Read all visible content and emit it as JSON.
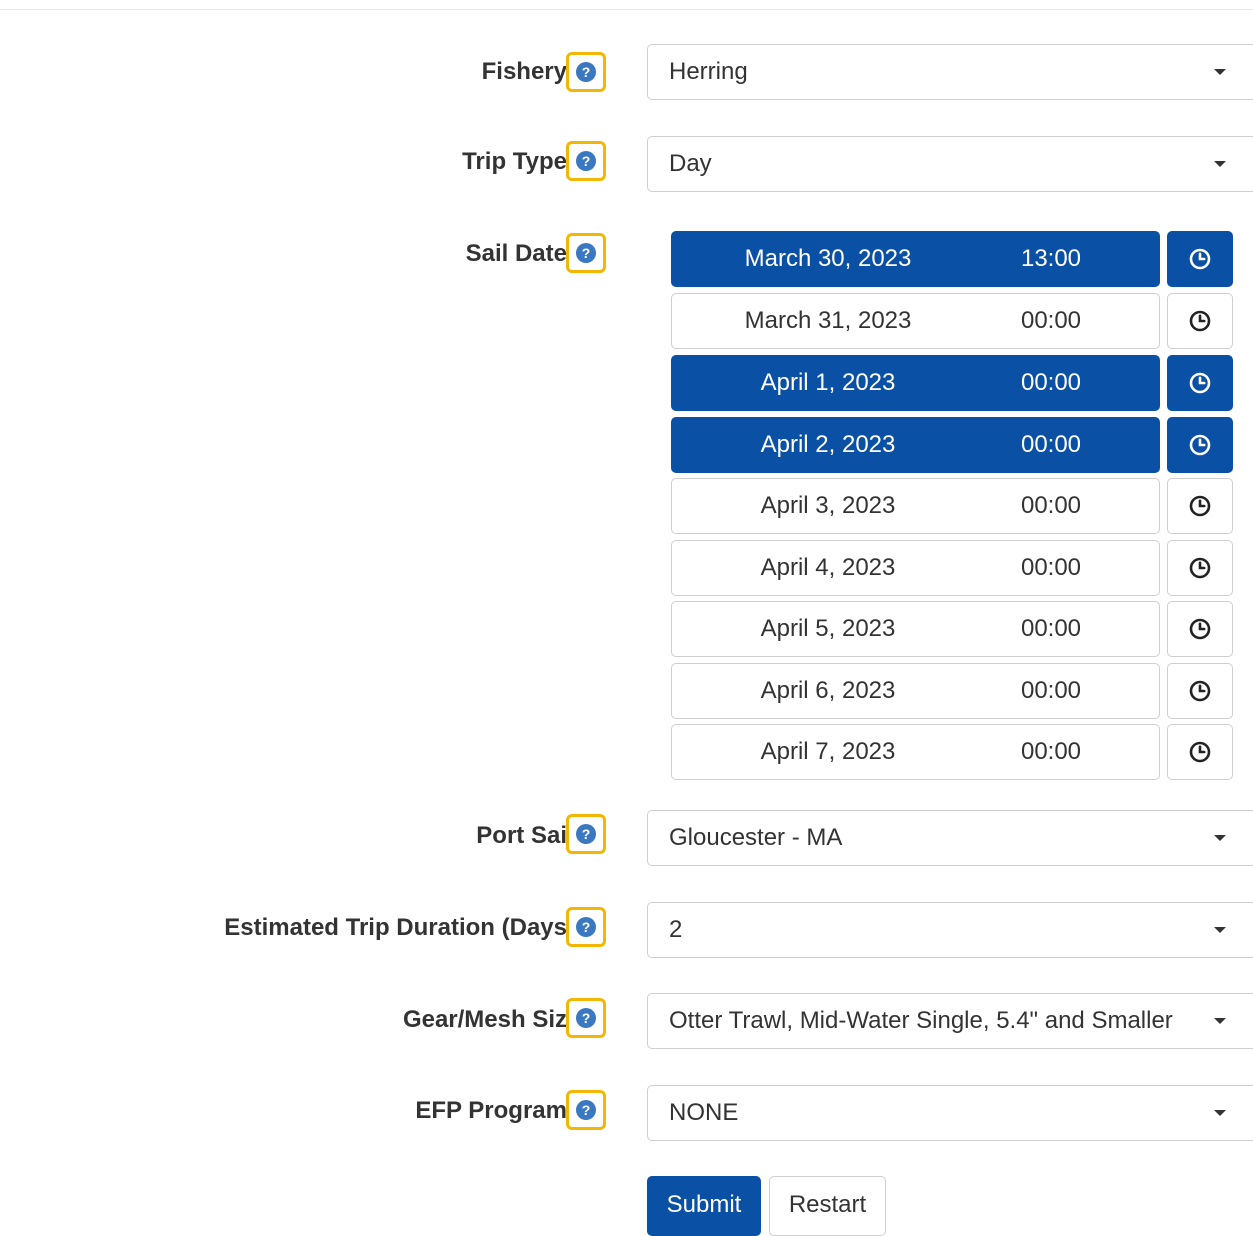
{
  "colors": {
    "accent": "#0a50a4",
    "help_border": "#f2b705",
    "help_icon": "#3a78c2"
  },
  "fishery": {
    "label": "Fishery",
    "value": "Herring",
    "help_icon": "question-circle-icon"
  },
  "trip_type": {
    "label": "Trip Type",
    "value": "Day"
  },
  "sail_date": {
    "label": "Sail Date",
    "rows": [
      {
        "date": "March 30, 2023",
        "time": "13:00",
        "selected": true
      },
      {
        "date": "March 31, 2023",
        "time": "00:00",
        "selected": false
      },
      {
        "date": "April 1, 2023",
        "time": "00:00",
        "selected": true
      },
      {
        "date": "April 2, 2023",
        "time": "00:00",
        "selected": true
      },
      {
        "date": "April 3, 2023",
        "time": "00:00",
        "selected": false
      },
      {
        "date": "April 4, 2023",
        "time": "00:00",
        "selected": false
      },
      {
        "date": "April 5, 2023",
        "time": "00:00",
        "selected": false
      },
      {
        "date": "April 6, 2023",
        "time": "00:00",
        "selected": false
      },
      {
        "date": "April 7, 2023",
        "time": "00:00",
        "selected": false
      }
    ]
  },
  "port_sail": {
    "label": "Port Sai",
    "value": "Gloucester - MA"
  },
  "trip_duration": {
    "label": "Estimated Trip Duration (Days",
    "value": "2"
  },
  "gear_mesh": {
    "label": "Gear/Mesh Siz",
    "value": "Otter Trawl, Mid-Water Single, 5.4\" and Smaller"
  },
  "efp_program": {
    "label": "EFP Program",
    "value": "NONE"
  },
  "buttons": {
    "submit": "Submit",
    "restart": "Restart"
  }
}
